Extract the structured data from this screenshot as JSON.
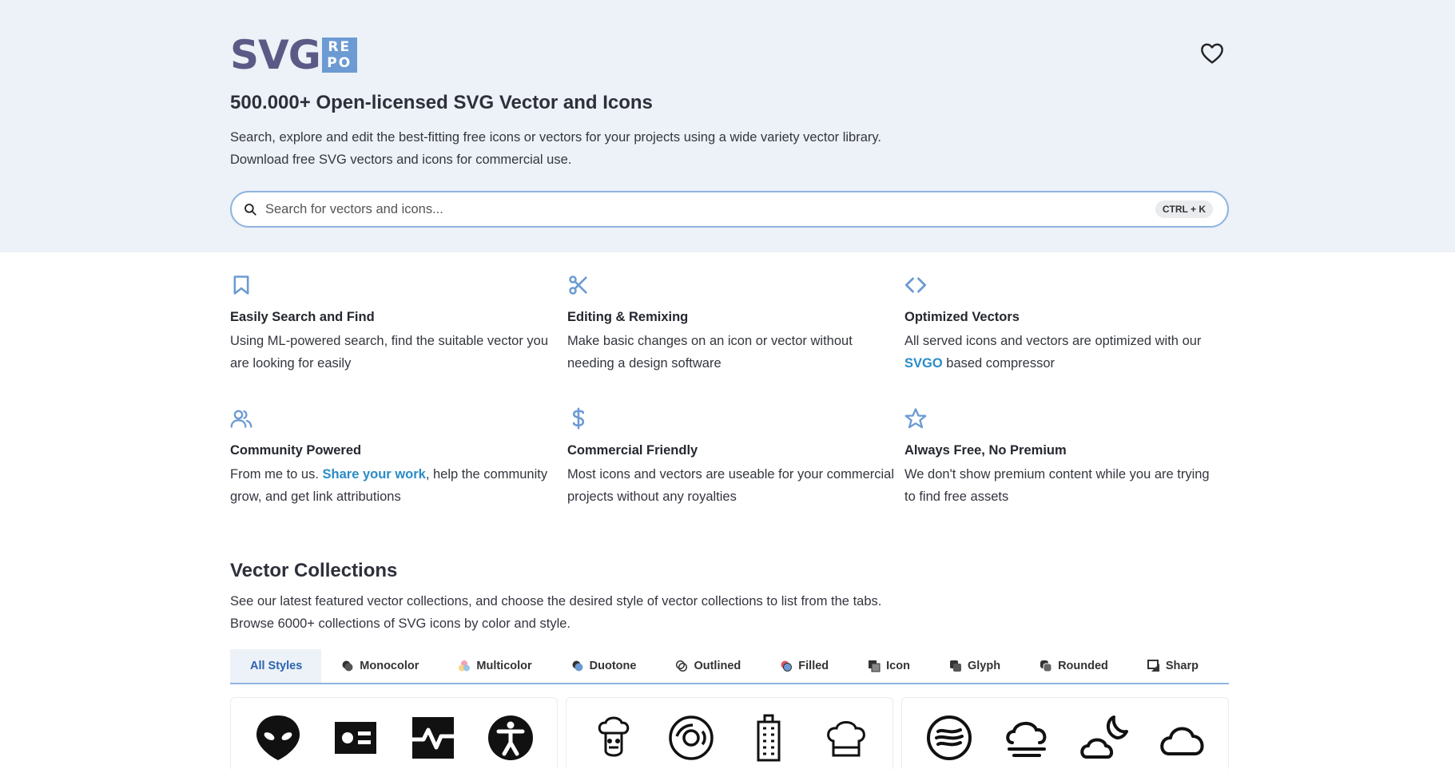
{
  "logo": {
    "text": "SVG",
    "box_line1": "RE",
    "box_line2": "PO"
  },
  "header": {
    "favorites_icon": "heart-icon"
  },
  "hero": {
    "title": "500.000+ Open-licensed SVG Vector and Icons",
    "desc_line1": "Search, explore and edit the best-fitting free icons or vectors for your projects using a wide variety vector library.",
    "desc_line2": "Download free SVG vectors and icons for commercial use."
  },
  "search": {
    "placeholder": "Search for vectors and icons...",
    "shortcut": "CTRL + K",
    "icon": "search-icon"
  },
  "features": [
    {
      "icon": "bookmark-icon",
      "title": "Easily Search and Find",
      "text": "Using ML-powered search, find the suitable vector you are looking for easily"
    },
    {
      "icon": "scissors-icon",
      "title": "Editing & Remixing",
      "text": "Make basic changes on an icon or vector without needing a design software"
    },
    {
      "icon": "code-icon",
      "title": "Optimized Vectors",
      "text_before": "All served icons and vectors are optimized with our ",
      "link": "SVGO",
      "text_after": " based compressor"
    },
    {
      "icon": "users-icon",
      "title": "Community Powered",
      "text_before": "From me to us. ",
      "link": "Share your work",
      "text_after": ", help the community grow, and get link attributions"
    },
    {
      "icon": "dollar-icon",
      "title": "Commercial Friendly",
      "text": "Most icons and vectors are useable for your commercial projects without any royalties"
    },
    {
      "icon": "star-icon",
      "title": "Always Free, No Premium",
      "text": "We don't show premium content while you are trying to find free assets"
    }
  ],
  "collections": {
    "title": "Vector Collections",
    "desc_line1": "See our latest featured vector collections, and choose the desired style of vector collections to list from the tabs.",
    "desc_line2": "Browse 6000+ collections of SVG icons by color and style.",
    "tabs": [
      "All Styles",
      "Monocolor",
      "Multicolor",
      "Duotone",
      "Outlined",
      "Filled",
      "Icon",
      "Glyph",
      "Rounded",
      "Sharp"
    ],
    "active_tab": "All Styles"
  },
  "colors": {
    "accent": "#6c9bd4",
    "link": "#2a8bc6",
    "hero_bg": "#edf1f8",
    "logo": "#5b5a86"
  }
}
